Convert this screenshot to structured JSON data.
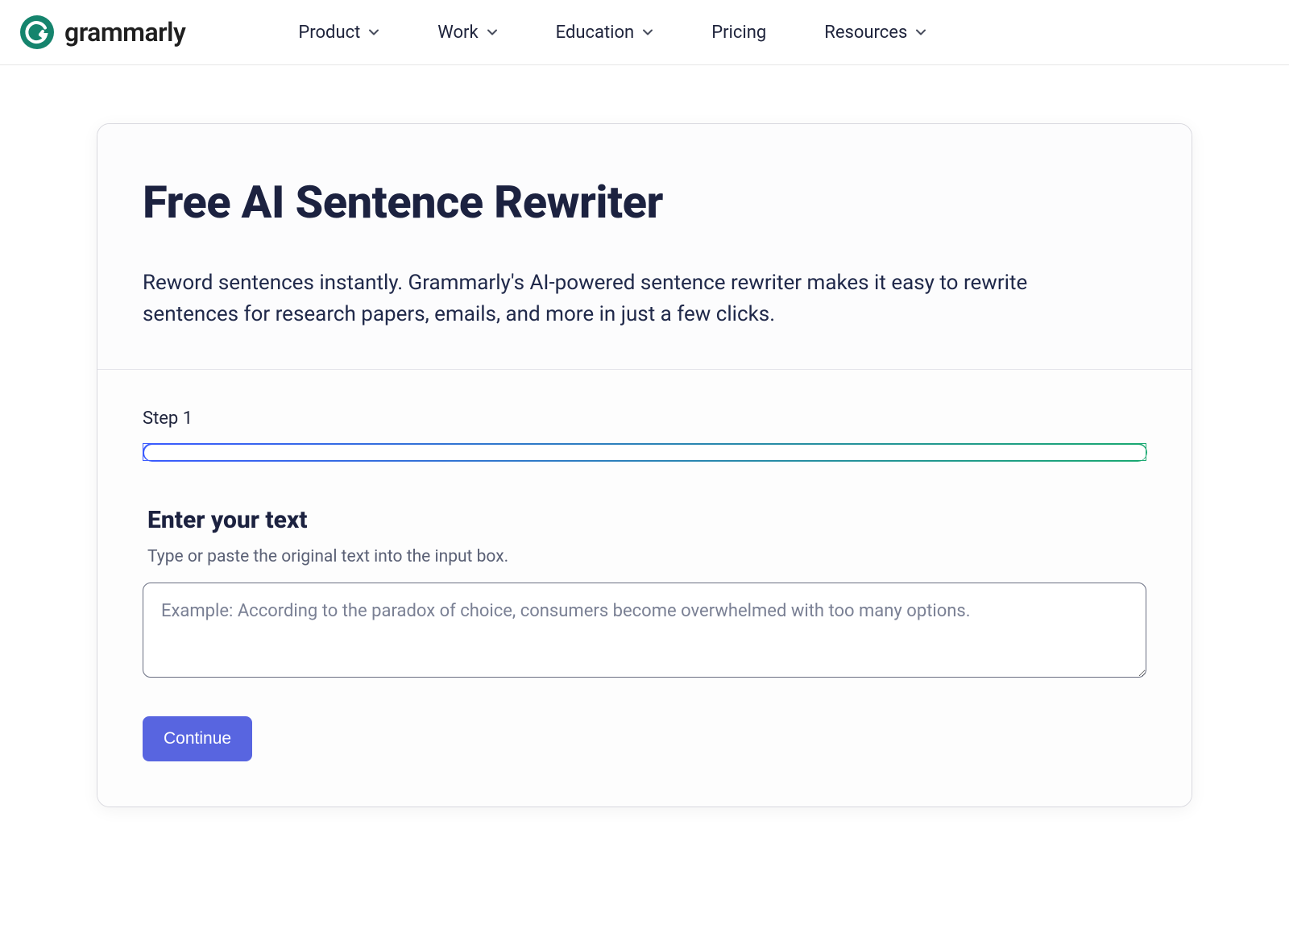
{
  "brand": {
    "name": "grammarly"
  },
  "nav": {
    "items": [
      {
        "label": "Product",
        "has_chevron": true
      },
      {
        "label": "Work",
        "has_chevron": true
      },
      {
        "label": "Education",
        "has_chevron": true
      },
      {
        "label": "Pricing",
        "has_chevron": false
      },
      {
        "label": "Resources",
        "has_chevron": true
      }
    ]
  },
  "card": {
    "title": "Free AI Sentence Rewriter",
    "subtitle": "Reword sentences instantly. Grammarly's AI-powered sentence rewriter makes it easy to rewrite sentences for research papers, emails, and more in just a few clicks.",
    "step_label": "Step 1",
    "section_heading": "Enter your text",
    "section_sub": "Type or paste the original text into the input box.",
    "placeholder": "Example: According to the paradox of choice, consumers become overwhelmed with too many options.",
    "continue_label": "Continue"
  }
}
